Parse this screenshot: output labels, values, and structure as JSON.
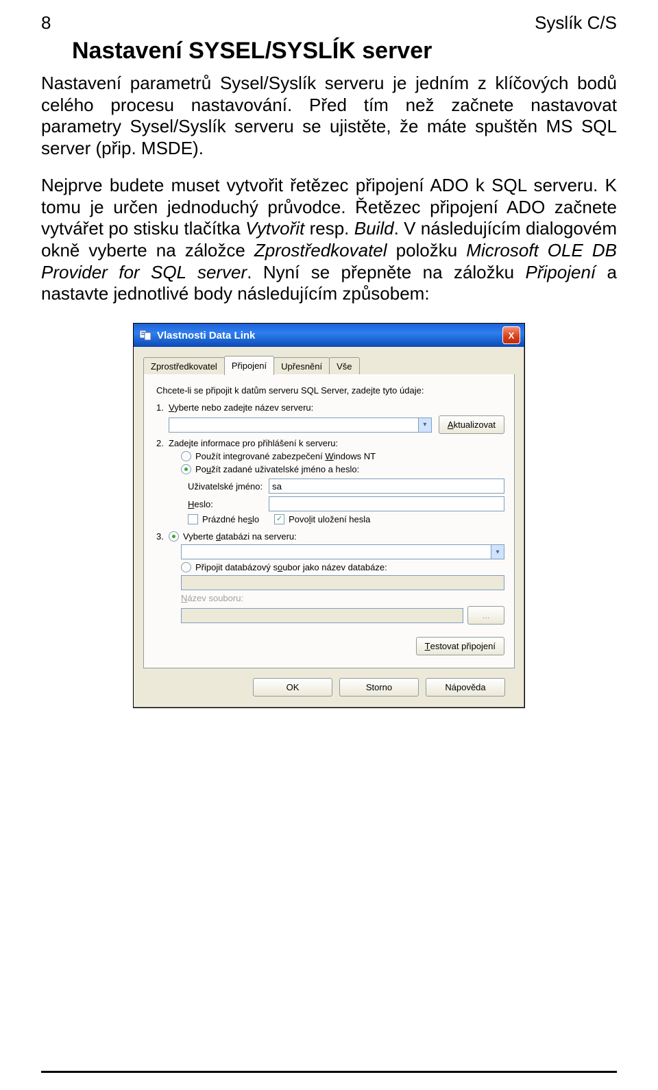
{
  "page": {
    "number": "8",
    "app_title": "Syslík C/S",
    "heading": "Nastavení SYSEL/SYSLÍK server",
    "para1": "Nastavení parametrů Sysel/Syslík serveru je jedním z klíčových bodů celého procesu nastavování. Před tím než začnete nastavovat parametry Sysel/Syslík serveru se ujistěte, že máte spuštěn MS SQL server (přip. MSDE).",
    "para2_a": "Nejprve budete muset vytvořit řetězec připojení ADO k SQL serveru. K tomu je určen jednoduchý průvodce. Řetězec připojení ADO začnete vytvářet po stisku tlačítka ",
    "para2_b_i": "Vytvořit",
    "para2_c": " resp. ",
    "para2_d_i": "Build",
    "para2_e": ". V následujícím dialogovém okně vyberte na záložce ",
    "para2_f_i": "Zprostředkovatel",
    "para2_g": " položku ",
    "para2_h_i": "Microsoft OLE DB Provider for SQL server",
    "para2_i": ". Nyní se přepněte na záložku ",
    "para2_j_i": "Připojení",
    "para2_k": " a nastavte jednotlivé body následujícím způsobem:"
  },
  "dlg": {
    "title": "Vlastnosti Data Link",
    "icon": "data-link-icon",
    "close": "X",
    "tabs": [
      "Zprostředkovatel",
      "Připojení",
      "Upřesnění",
      "Vše"
    ],
    "prompt": "Chcete-li se připojit k datům serveru SQL Server, zadejte tyto údaje:",
    "step1_num": "1.",
    "step1": "V",
    "step1_rest": "yberte nebo zadejte název serveru:",
    "btn_refresh_u": "A",
    "btn_refresh": "ktualizovat",
    "step2_num": "2.",
    "step2": "Zadejte informace pro přihlášení k serveru:",
    "radio_a": "Použít inte",
    "radio_a_u": "g",
    "radio_a2": "rované zabezpečení ",
    "radio_a_u2": "W",
    "radio_a3": "indows NT",
    "radio_b": "Po",
    "radio_b_u": "u",
    "radio_b2": "žít zadané uživatelské jméno a heslo:",
    "lbl_user": "Uživatelské ",
    "lbl_user_u": "j",
    "lbl_user2": "méno:",
    "val_user": "sa",
    "lbl_pass_u": "H",
    "lbl_pass": "eslo:",
    "val_pass": "",
    "chk_blank": "Prázdné he",
    "chk_blank_u": "s",
    "chk_blank2": "lo",
    "chk_save": "Povo",
    "chk_save_u": "l",
    "chk_save2": "it uložení hesla",
    "step3_num": "3.",
    "radio_db": "Vyberte ",
    "radio_db_u": "d",
    "radio_db2": "atabázi na serveru:",
    "radio_file": "Připojit databázový s",
    "radio_file_u": "o",
    "radio_file2": "ubor jako název databáze:",
    "lbl_filename_u": "N",
    "lbl_filename": "ázev souboru:",
    "btn_test_u": "T",
    "btn_test": "estovat připojení",
    "btn_ok": "OK",
    "btn_cancel": "Storno",
    "btn_help": "Nápověda"
  }
}
